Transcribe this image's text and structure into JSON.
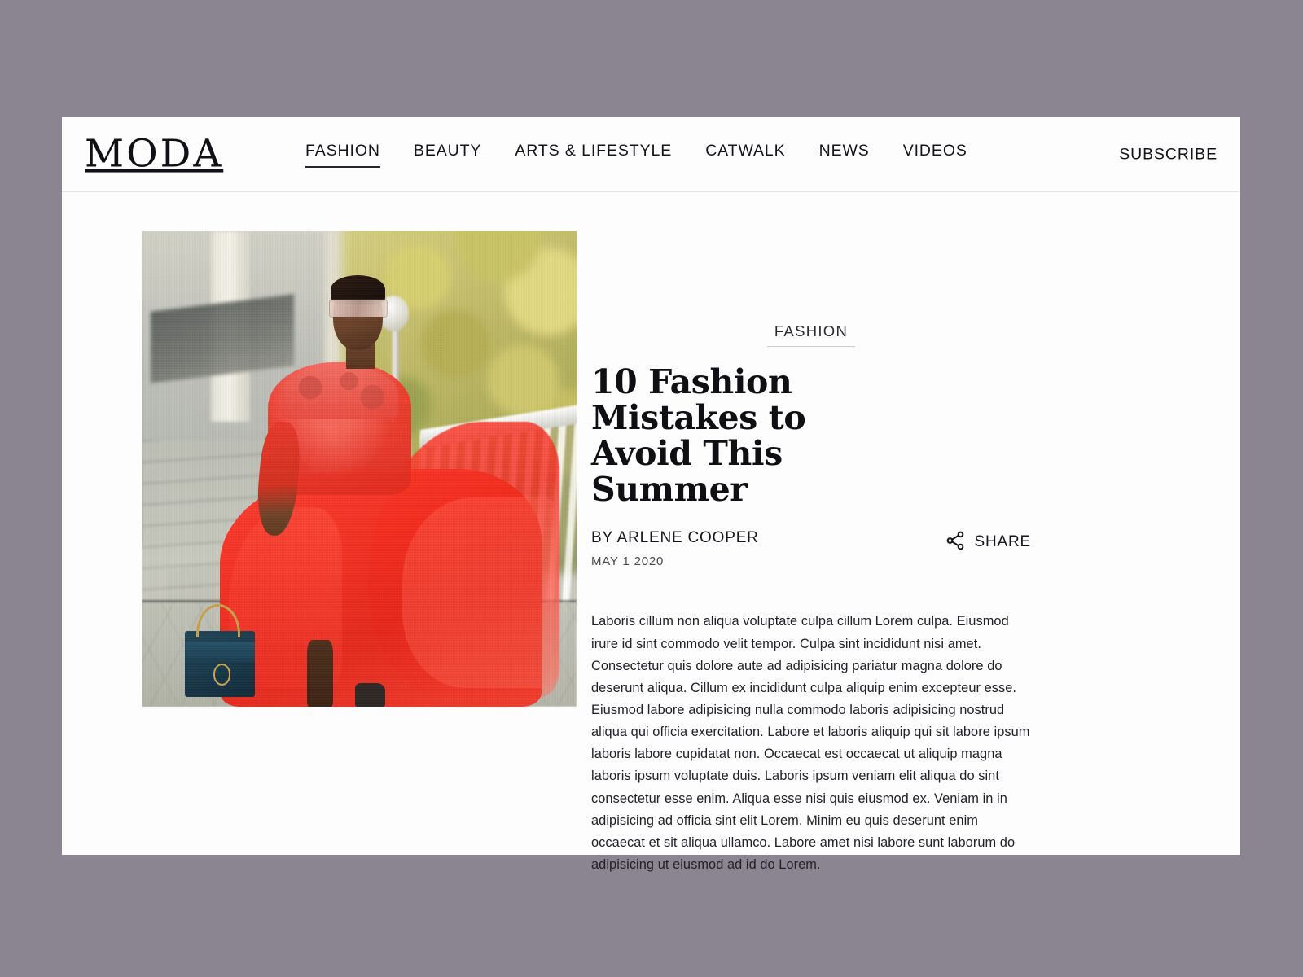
{
  "theme": {
    "page_background": "#8b8491",
    "card_background": "#fdfdfd",
    "text_primary": "#100f14",
    "text_body": "#232229",
    "rule_color": "#e4e2e6",
    "accent_red": "#f03223"
  },
  "header": {
    "logo": "MODA",
    "nav": [
      {
        "label": "FASHION",
        "active": true
      },
      {
        "label": "BEAUTY",
        "active": false
      },
      {
        "label": "ARTS & LIFESTYLE",
        "active": false
      },
      {
        "label": "CATWALK",
        "active": false
      },
      {
        "label": "NEWS",
        "active": false
      },
      {
        "label": "VIDEOS",
        "active": false
      }
    ],
    "subscribe_label": "SUBSCRIBE"
  },
  "article": {
    "category": "FASHION",
    "headline": "10 Fashion Mistakes to Avoid This Summer",
    "author": "BY ARLENE COOPER",
    "date": "MAY 1 2020",
    "share_label": "SHARE",
    "share_icon": "share-nodes-icon",
    "body": "Laboris cillum non aliqua voluptate culpa cillum Lorem culpa. Eiusmod irure id sint commodo velit tempor. Culpa sint incididunt nisi amet. Consectetur quis dolore aute ad adipisicing pariatur magna dolore do deserunt aliqua. Cillum ex incididunt culpa aliquip enim excepteur esse. Eiusmod labore adipisicing nulla commodo laboris adipisicing nostrud aliqua qui officia exercitation. Labore et laboris aliquip qui sit labore ipsum laboris labore cupidatat non. Occaecat est occaecat ut aliquip magna laboris ipsum voluptate duis. Laboris ipsum veniam elit aliqua do sint consectetur esse enim. Aliqua esse nisi quis eiusmod ex. Veniam in in adipisicing ad officia sint elit Lorem. Minim eu quis deserunt enim occaecat et sit aliqua ullamco. Labore amet nisi labore sunt laborum do adipisicing ut eiusmod ad id do Lorem.",
    "hero_image_alt": "Woman in a red tulle dress with sunglasses standing on stone stairs beside a white balustrade, yellow foliage behind"
  }
}
